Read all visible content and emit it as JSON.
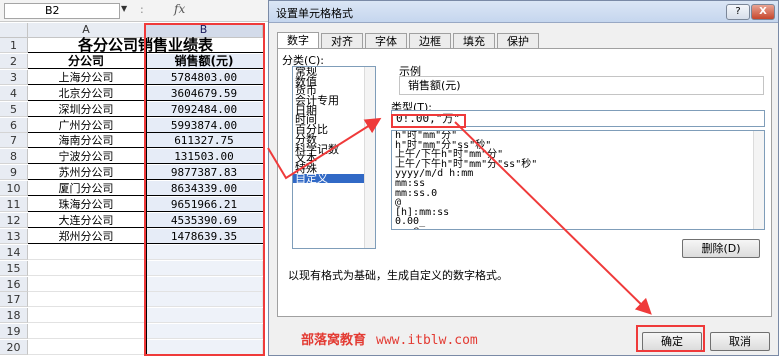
{
  "sheet": {
    "namebox": "B2",
    "fx": "fx",
    "columns": [
      "A",
      "B"
    ],
    "rows": [
      {
        "n": "1",
        "a": "",
        "b": "各分公司销售业绩表"
      },
      {
        "n": "2",
        "a": "分公司",
        "b": "销售额(元)"
      },
      {
        "n": "3",
        "a": "上海分公司",
        "b": "5784803.00"
      },
      {
        "n": "4",
        "a": "北京分公司",
        "b": "3604679.59"
      },
      {
        "n": "5",
        "a": "深圳分公司",
        "b": "7092484.00"
      },
      {
        "n": "6",
        "a": "广州分公司",
        "b": "5993874.00"
      },
      {
        "n": "7",
        "a": "海南分公司",
        "b": "611327.75"
      },
      {
        "n": "8",
        "a": "宁波分公司",
        "b": "131503.00"
      },
      {
        "n": "9",
        "a": "苏州分公司",
        "b": "9877387.83"
      },
      {
        "n": "10",
        "a": "厦门分公司",
        "b": "8634339.00"
      },
      {
        "n": "11",
        "a": "珠海分公司",
        "b": "9651966.21"
      },
      {
        "n": "12",
        "a": "大连分公司",
        "b": "4535390.69"
      },
      {
        "n": "13",
        "a": "郑州分公司",
        "b": "1478639.35"
      },
      {
        "n": "14",
        "a": "",
        "b": ""
      },
      {
        "n": "15",
        "a": "",
        "b": ""
      },
      {
        "n": "16",
        "a": "",
        "b": ""
      },
      {
        "n": "17",
        "a": "",
        "b": ""
      },
      {
        "n": "18",
        "a": "",
        "b": ""
      },
      {
        "n": "19",
        "a": "",
        "b": ""
      },
      {
        "n": "20",
        "a": "",
        "b": ""
      }
    ]
  },
  "dialog": {
    "title": "设置单元格格式",
    "help": "?",
    "close": "X",
    "tabs": [
      "数字",
      "对齐",
      "字体",
      "边框",
      "填充",
      "保护"
    ],
    "active_tab": "数字",
    "category_label": "分类(C):",
    "categories": [
      "常规",
      "数值",
      "货币",
      "会计专用",
      "日期",
      "时间",
      "百分比",
      "分数",
      "科学记数",
      "文本",
      "特殊",
      "自定义"
    ],
    "selected_category": "自定义",
    "sample_label": "示例",
    "sample_value": "销售额(元)",
    "type_label": "类型(T):",
    "type_value": "0!.00,\"万\"",
    "formats": [
      "h\"时\"mm\"分\"",
      "h\"时\"mm\"分\"ss\"秒\"",
      "上午/下午h\"时\"mm\"分\"",
      "上午/下午h\"时\"mm\"分\"ss\"秒\"",
      "yyyy/m/d h:mm",
      "mm:ss",
      "mm:ss.0",
      "@",
      "[h]:mm:ss",
      "0.00_",
      ";;;@"
    ],
    "delete_button": "删除(D)",
    "description": "以现有格式为基础，生成自定义的数字格式。",
    "ok": "确定",
    "cancel": "取消"
  },
  "watermark": {
    "brand": "部落窝教育",
    "url": "www.itblw.com"
  },
  "colors": {
    "highlight": "#ef3a3a",
    "selected": "#3169c6",
    "column_selected": "#d3dbea"
  }
}
